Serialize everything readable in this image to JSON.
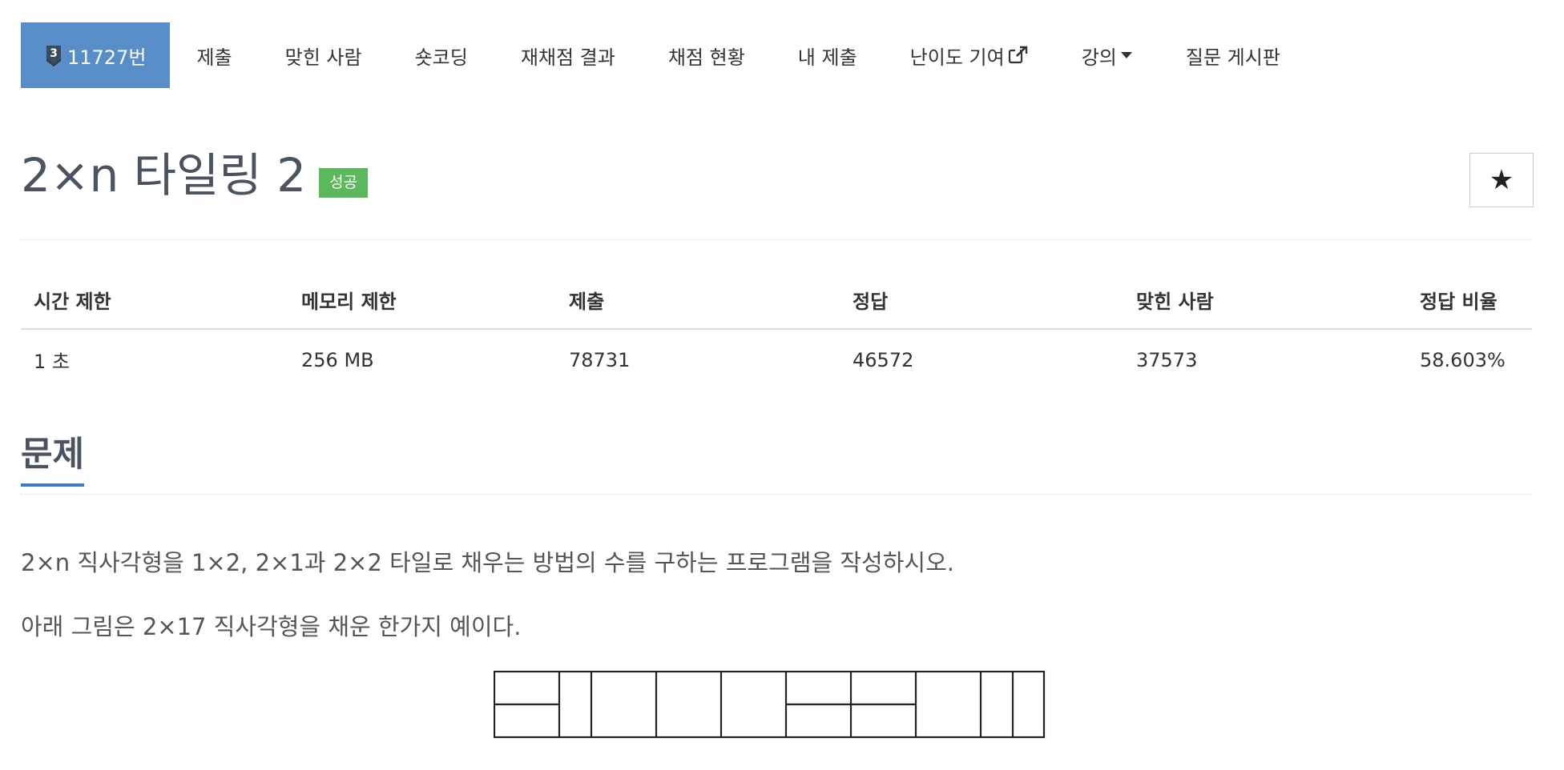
{
  "nav": {
    "tier_badge_text": "3",
    "problem_number": "11727번",
    "items": [
      {
        "label": "제출"
      },
      {
        "label": "맞힌 사람"
      },
      {
        "label": "숏코딩"
      },
      {
        "label": "재채점 결과"
      },
      {
        "label": "채점 현황"
      },
      {
        "label": "내 제출"
      },
      {
        "label": "난이도 기여"
      },
      {
        "label": "강의"
      },
      {
        "label": "질문 게시판"
      }
    ]
  },
  "header": {
    "title": "2×n 타일링 2",
    "status": "성공",
    "star": "★"
  },
  "info": {
    "headers": [
      "시간 제한",
      "메모리 제한",
      "제출",
      "정답",
      "맞힌 사람",
      "정답 비율"
    ],
    "values": [
      "1 초",
      "256 MB",
      "78731",
      "46572",
      "37573",
      "58.603%"
    ]
  },
  "problem": {
    "section_title": "문제",
    "line1": "2×n 직사각형을 1×2, 2×1과 2×2 타일로 채우는 방법의 수를 구하는 프로그램을 작성하시오.",
    "line2": "아래 그림은 2×17 직사각형을 채운 한가지 예이다."
  },
  "colors": {
    "accent": "#588ec8",
    "success": "#5cb85c",
    "section_underline": "#3f7ac2"
  },
  "icons": {
    "tier": "tier-shield-icon",
    "external": "external-link-icon",
    "caret": "caret-down-icon",
    "star": "star-icon"
  }
}
